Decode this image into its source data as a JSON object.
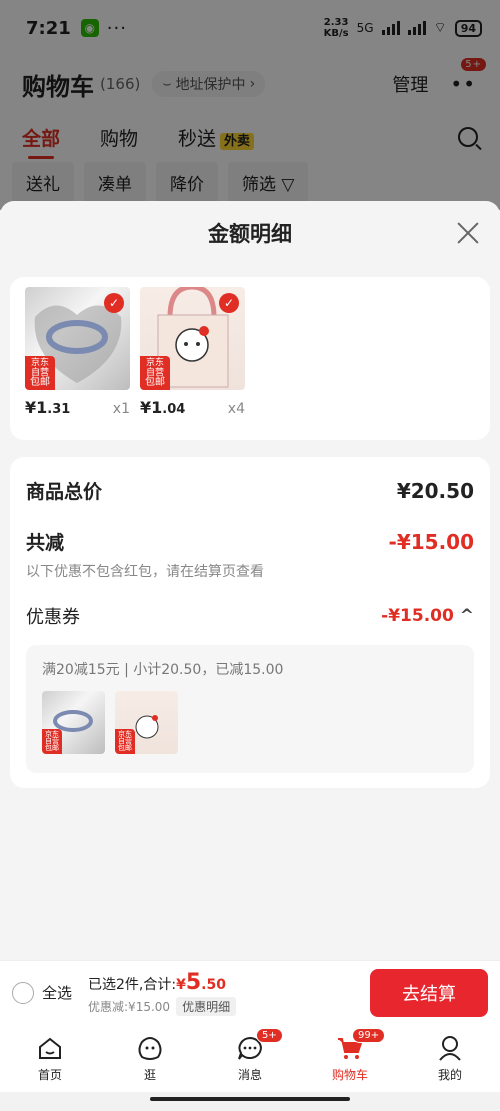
{
  "status_bar": {
    "time": "7:21",
    "dots": "···",
    "net_speed": "2.33",
    "net_unit": "KB/s",
    "signal_label": "5G",
    "battery": "94"
  },
  "header": {
    "title": "购物车",
    "count": "(166)",
    "address_protect": "地址保护中",
    "manage": "管理",
    "more_badge": "5+"
  },
  "tabs": [
    {
      "label": "全部"
    },
    {
      "label": "购物"
    },
    {
      "label": "秒送",
      "badge": "外卖"
    }
  ],
  "chips": [
    "送礼",
    "凑单",
    "降价",
    "筛选"
  ],
  "sheet": {
    "title": "金额明细",
    "items": [
      {
        "tag_top": "京东自营",
        "tag_bottom": "包邮",
        "price_int": "¥1",
        "price_dec": ".31",
        "qty": "x1"
      },
      {
        "tag_top": "京东自营",
        "tag_bottom": "包邮",
        "price_int": "¥1",
        "price_dec": ".04",
        "qty": "x4"
      }
    ],
    "summary": {
      "total_label": "商品总价",
      "total_value": "¥20.50",
      "reduce_label": "共减",
      "reduce_value": "-¥15.00",
      "reduce_note": "以下优惠不包含红包，请在结算页查看",
      "coupon_label": "优惠券",
      "coupon_value": "-¥15.00",
      "coupon_desc": "满20减15元 | 小计20.50，已减15.00"
    }
  },
  "checkout": {
    "select_all": "全选",
    "selected_text": "已选2件,合计:",
    "currency": "¥",
    "amount_int": "5",
    "amount_dec": ".50",
    "discount_text": "优惠减:¥15.00",
    "detail_btn": "优惠明细",
    "pay_btn": "去结算"
  },
  "nav": [
    {
      "label": "首页",
      "icon": "home-icon"
    },
    {
      "label": "逛",
      "icon": "browse-icon"
    },
    {
      "label": "消息",
      "icon": "message-icon",
      "badge": "5+"
    },
    {
      "label": "购物车",
      "icon": "cart-icon",
      "badge": "99+"
    },
    {
      "label": "我的",
      "icon": "profile-icon"
    }
  ],
  "colors": {
    "accent": "#e02e24",
    "pay_button": "#e8262e"
  }
}
